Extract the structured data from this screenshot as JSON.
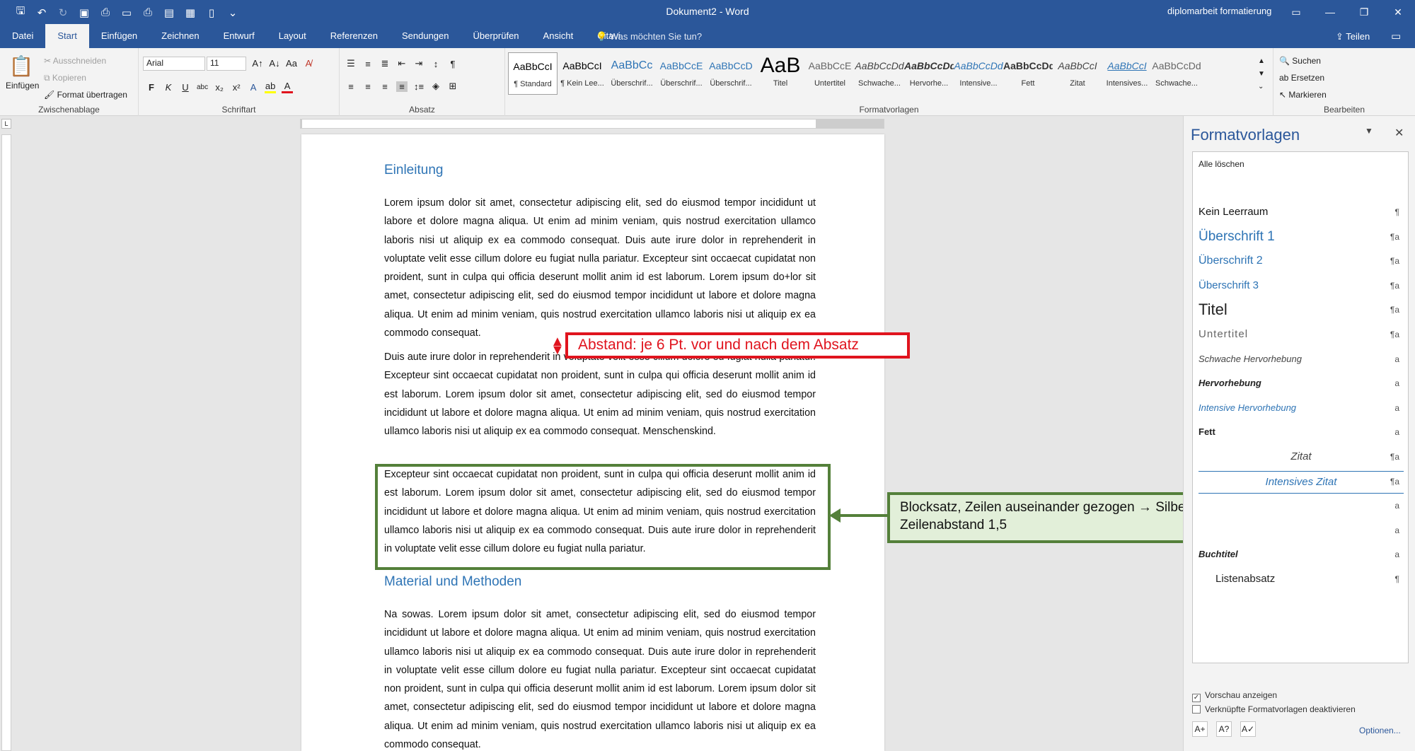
{
  "window": {
    "doc_title": "Dokument2  -  Word",
    "right_title": "diplomarbeit formatierung",
    "tell_me": "Was möchten Sie tun?",
    "share": "Teilen"
  },
  "tabs": [
    "Datei",
    "Start",
    "Einfügen",
    "Zeichnen",
    "Entwurf",
    "Layout",
    "Referenzen",
    "Sendungen",
    "Überprüfen",
    "Ansicht",
    "Citavi"
  ],
  "ribbon": {
    "clipboard": {
      "paste": "Einfügen",
      "cut": "Ausschneiden",
      "copy": "Kopieren",
      "format_painter": "Format übertragen",
      "label": "Zwischenablage"
    },
    "font": {
      "name": "Arial",
      "size": "11",
      "label": "Schriftart"
    },
    "paragraph": {
      "label": "Absatz"
    },
    "styles": {
      "label": "Formatvorlagen",
      "tiles": [
        {
          "preview": "AaBbCcI",
          "name": "¶ Standard"
        },
        {
          "preview": "AaBbCcI",
          "name": "¶ Kein Lee..."
        },
        {
          "preview": "AaBbCc",
          "name": "Überschrif..."
        },
        {
          "preview": "AaBbCcE",
          "name": "Überschrif..."
        },
        {
          "preview": "AaBbCcD",
          "name": "Überschrif..."
        },
        {
          "preview": "AaB",
          "name": "Titel"
        },
        {
          "preview": "AaBbCcE",
          "name": "Untertitel"
        },
        {
          "preview": "AaBbCcDd",
          "name": "Schwache..."
        },
        {
          "preview": "AaBbCcDd",
          "name": "Hervorhe..."
        },
        {
          "preview": "AaBbCcDd",
          "name": "Intensive..."
        },
        {
          "preview": "AaBbCcDd",
          "name": "Fett"
        },
        {
          "preview": "AaBbCcI",
          "name": "Zitat"
        },
        {
          "preview": "AaBbCcI",
          "name": "Intensives..."
        },
        {
          "preview": "AaBbCcDd",
          "name": "Schwache..."
        }
      ]
    },
    "editing": {
      "find": "Suchen",
      "replace": "Ersetzen",
      "select": "Markieren",
      "label": "Bearbeiten"
    }
  },
  "document": {
    "heading1": "Einleitung",
    "para1": "Lorem ipsum dolor sit amet, consectetur adipiscing elit, sed do eiusmod tempor incididunt ut labore et dolore magna aliqua. Ut enim ad minim veniam, quis nostrud exercitation ullamco laboris nisi ut aliquip ex ea commodo consequat. Duis aute irure dolor in reprehenderit in voluptate velit esse cillum dolore eu fugiat nulla pariatur. Excepteur sint occaecat cupidatat non proident, sunt in culpa qui officia deserunt mollit anim id est laborum. Lorem ipsum do+lor sit amet, consectetur adipiscing elit, sed do eiusmod tempor incididunt ut labore et dolore magna aliqua. Ut enim ad minim veniam, quis nostrud exercitation ullamco laboris nisi ut aliquip ex ea commodo consequat.",
    "para2": "Duis aute irure dolor in reprehenderit in voluptate velit esse cillum dolore eu fugiat nulla pariatur. Excepteur sint occaecat cupidatat non proident, sunt in culpa qui officia deserunt mollit anim id est laborum. Lorem ipsum dolor sit amet, consectetur adipiscing elit, sed do eiusmod tempor incididunt ut labore et dolore magna aliqua. Ut enim ad minim veniam, quis nostrud exercitation ullamco laboris nisi ut aliquip ex ea commodo consequat. Menschenskind.",
    "para3": "Excepteur sint occaecat cupidatat non proident, sunt in culpa qui officia deserunt mollit anim id est laborum. Lorem ipsum dolor sit amet, consectetur adipiscing elit, sed do eiusmod tempor incididunt ut labore et dolore magna aliqua. Ut enim ad minim veniam, quis nostrud exercitation ullamco laboris nisi ut aliquip ex ea commodo consequat. Duis aute irure dolor in reprehenderit in voluptate velit esse cillum dolore eu fugiat nulla pariatur.",
    "heading2": "Material und Methoden",
    "para4": "Na sowas. Lorem ipsum dolor sit amet, consectetur adipiscing elit, sed do eiusmod tempor incididunt ut labore et dolore magna aliqua. Ut enim ad minim veniam, quis nostrud exercitation ullamco laboris nisi ut aliquip ex ea commodo consequat. Duis aute irure dolor in reprehenderit in voluptate velit esse cillum dolore eu fugiat nulla pariatur. Excepteur sint occaecat cupidatat non proident, sunt in culpa qui officia deserunt mollit anim id est laborum. Lorem ipsum dolor sit amet, consectetur adipiscing elit, sed do eiusmod tempor incididunt ut labore et dolore magna aliqua. Ut enim ad minim veniam, quis nostrud exercitation ullamco laboris nisi ut aliquip ex ea commodo consequat."
  },
  "annotations": {
    "spacing": "Abstand: je  6 Pt. vor und nach dem Absatz",
    "justify_line1": "Blocksatz, Zeilen auseinander gezogen → Silbentrennung nötig",
    "justify_line2": "Zeilenabstand 1,5"
  },
  "styles_pane": {
    "title": "Formatvorlagen",
    "clear_all": "Alle löschen",
    "items": [
      {
        "name": "Kein Leerraum",
        "mark": "¶"
      },
      {
        "name": "Überschrift 1",
        "mark": "¶a"
      },
      {
        "name": "Überschrift 2",
        "mark": "¶a"
      },
      {
        "name": "Überschrift 3",
        "mark": "¶a"
      },
      {
        "name": "Titel",
        "mark": "¶a"
      },
      {
        "name": "Untertitel",
        "mark": "¶a"
      },
      {
        "name": "Schwache Hervorhebung",
        "mark": "a"
      },
      {
        "name": "Hervorhebung",
        "mark": "a"
      },
      {
        "name": "Intensive Hervorhebung",
        "mark": "a"
      },
      {
        "name": "Fett",
        "mark": "a"
      },
      {
        "name": "Zitat",
        "mark": "¶a"
      },
      {
        "name": "Intensives Zitat",
        "mark": "¶a"
      },
      {
        "name": "",
        "mark": "a"
      },
      {
        "name": "",
        "mark": "a"
      },
      {
        "name": "Buchtitel",
        "mark": "a"
      },
      {
        "name": "Listenabsatz",
        "mark": "¶"
      }
    ],
    "show_preview": "Vorschau anzeigen",
    "disable_linked": "Verknüpfte Formatvorlagen deaktivieren",
    "options": "Optionen..."
  },
  "colors": {
    "word_blue": "#2b579a",
    "annotation_red": "#e0141e",
    "annotation_green": "#54803a",
    "heading_blue": "#2e74b5"
  }
}
